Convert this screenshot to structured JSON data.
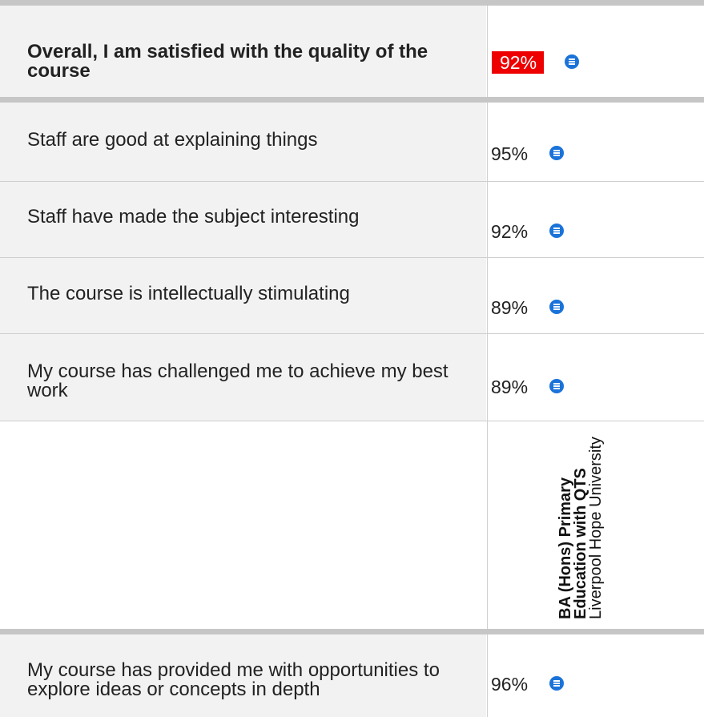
{
  "course": {
    "name": "BA (Hons) Primary Education with QTS",
    "provider": "Liverpool Hope University"
  },
  "questions": [
    {
      "text": "Overall, I am satisfied with the quality of the course",
      "score": "92%",
      "highlighted": true
    },
    {
      "text": "Staff are good at explaining things",
      "score": "95%"
    },
    {
      "text": "Staff have made the subject interesting",
      "score": "92%"
    },
    {
      "text": "The course is intellectually stimulating",
      "score": "89%"
    },
    {
      "text": "My course has challenged me to achieve my best work",
      "score": "89%"
    },
    {
      "text": "My course has provided me with opportunities to explore ideas or concepts in depth",
      "score": "96%"
    }
  ],
  "icons": {
    "info": "info-list-icon"
  },
  "colors": {
    "highlight": "#ee0000",
    "info_icon": "#1a73d9",
    "question_background": "#f2f2f2"
  }
}
